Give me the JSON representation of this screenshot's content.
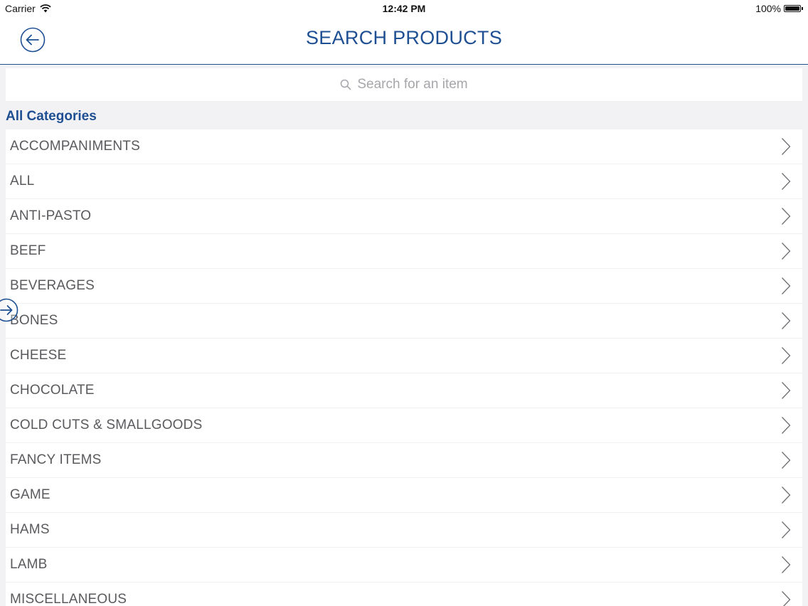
{
  "status_bar": {
    "carrier": "Carrier",
    "time": "12:42 PM",
    "battery": "100%",
    "wifi_icon": "wifi-icon",
    "battery_icon": "battery-full-icon"
  },
  "header": {
    "title": "SEARCH PRODUCTS",
    "back_icon": "arrow-left-circle-icon"
  },
  "search": {
    "placeholder": "Search for an item",
    "icon": "search-icon"
  },
  "section": {
    "title": "All Categories"
  },
  "categories": [
    {
      "label": "ACCOMPANIMENTS"
    },
    {
      "label": "ALL"
    },
    {
      "label": "ANTI-PASTO"
    },
    {
      "label": "BEEF"
    },
    {
      "label": "BEVERAGES"
    },
    {
      "label": "BONES"
    },
    {
      "label": "CHEESE"
    },
    {
      "label": "CHOCOLATE"
    },
    {
      "label": "COLD CUTS & SMALLGOODS"
    },
    {
      "label": "FANCY ITEMS"
    },
    {
      "label": "GAME"
    },
    {
      "label": "HAMS"
    },
    {
      "label": "LAMB"
    },
    {
      "label": "MISCELLANEOUS"
    }
  ],
  "side_toggle": {
    "icon": "arrow-right-circle-icon"
  },
  "colors": {
    "accent": "#1f4f93",
    "item_text": "#5a5a5e",
    "placeholder": "#a6a6ab",
    "background": "#f2f2f4"
  }
}
